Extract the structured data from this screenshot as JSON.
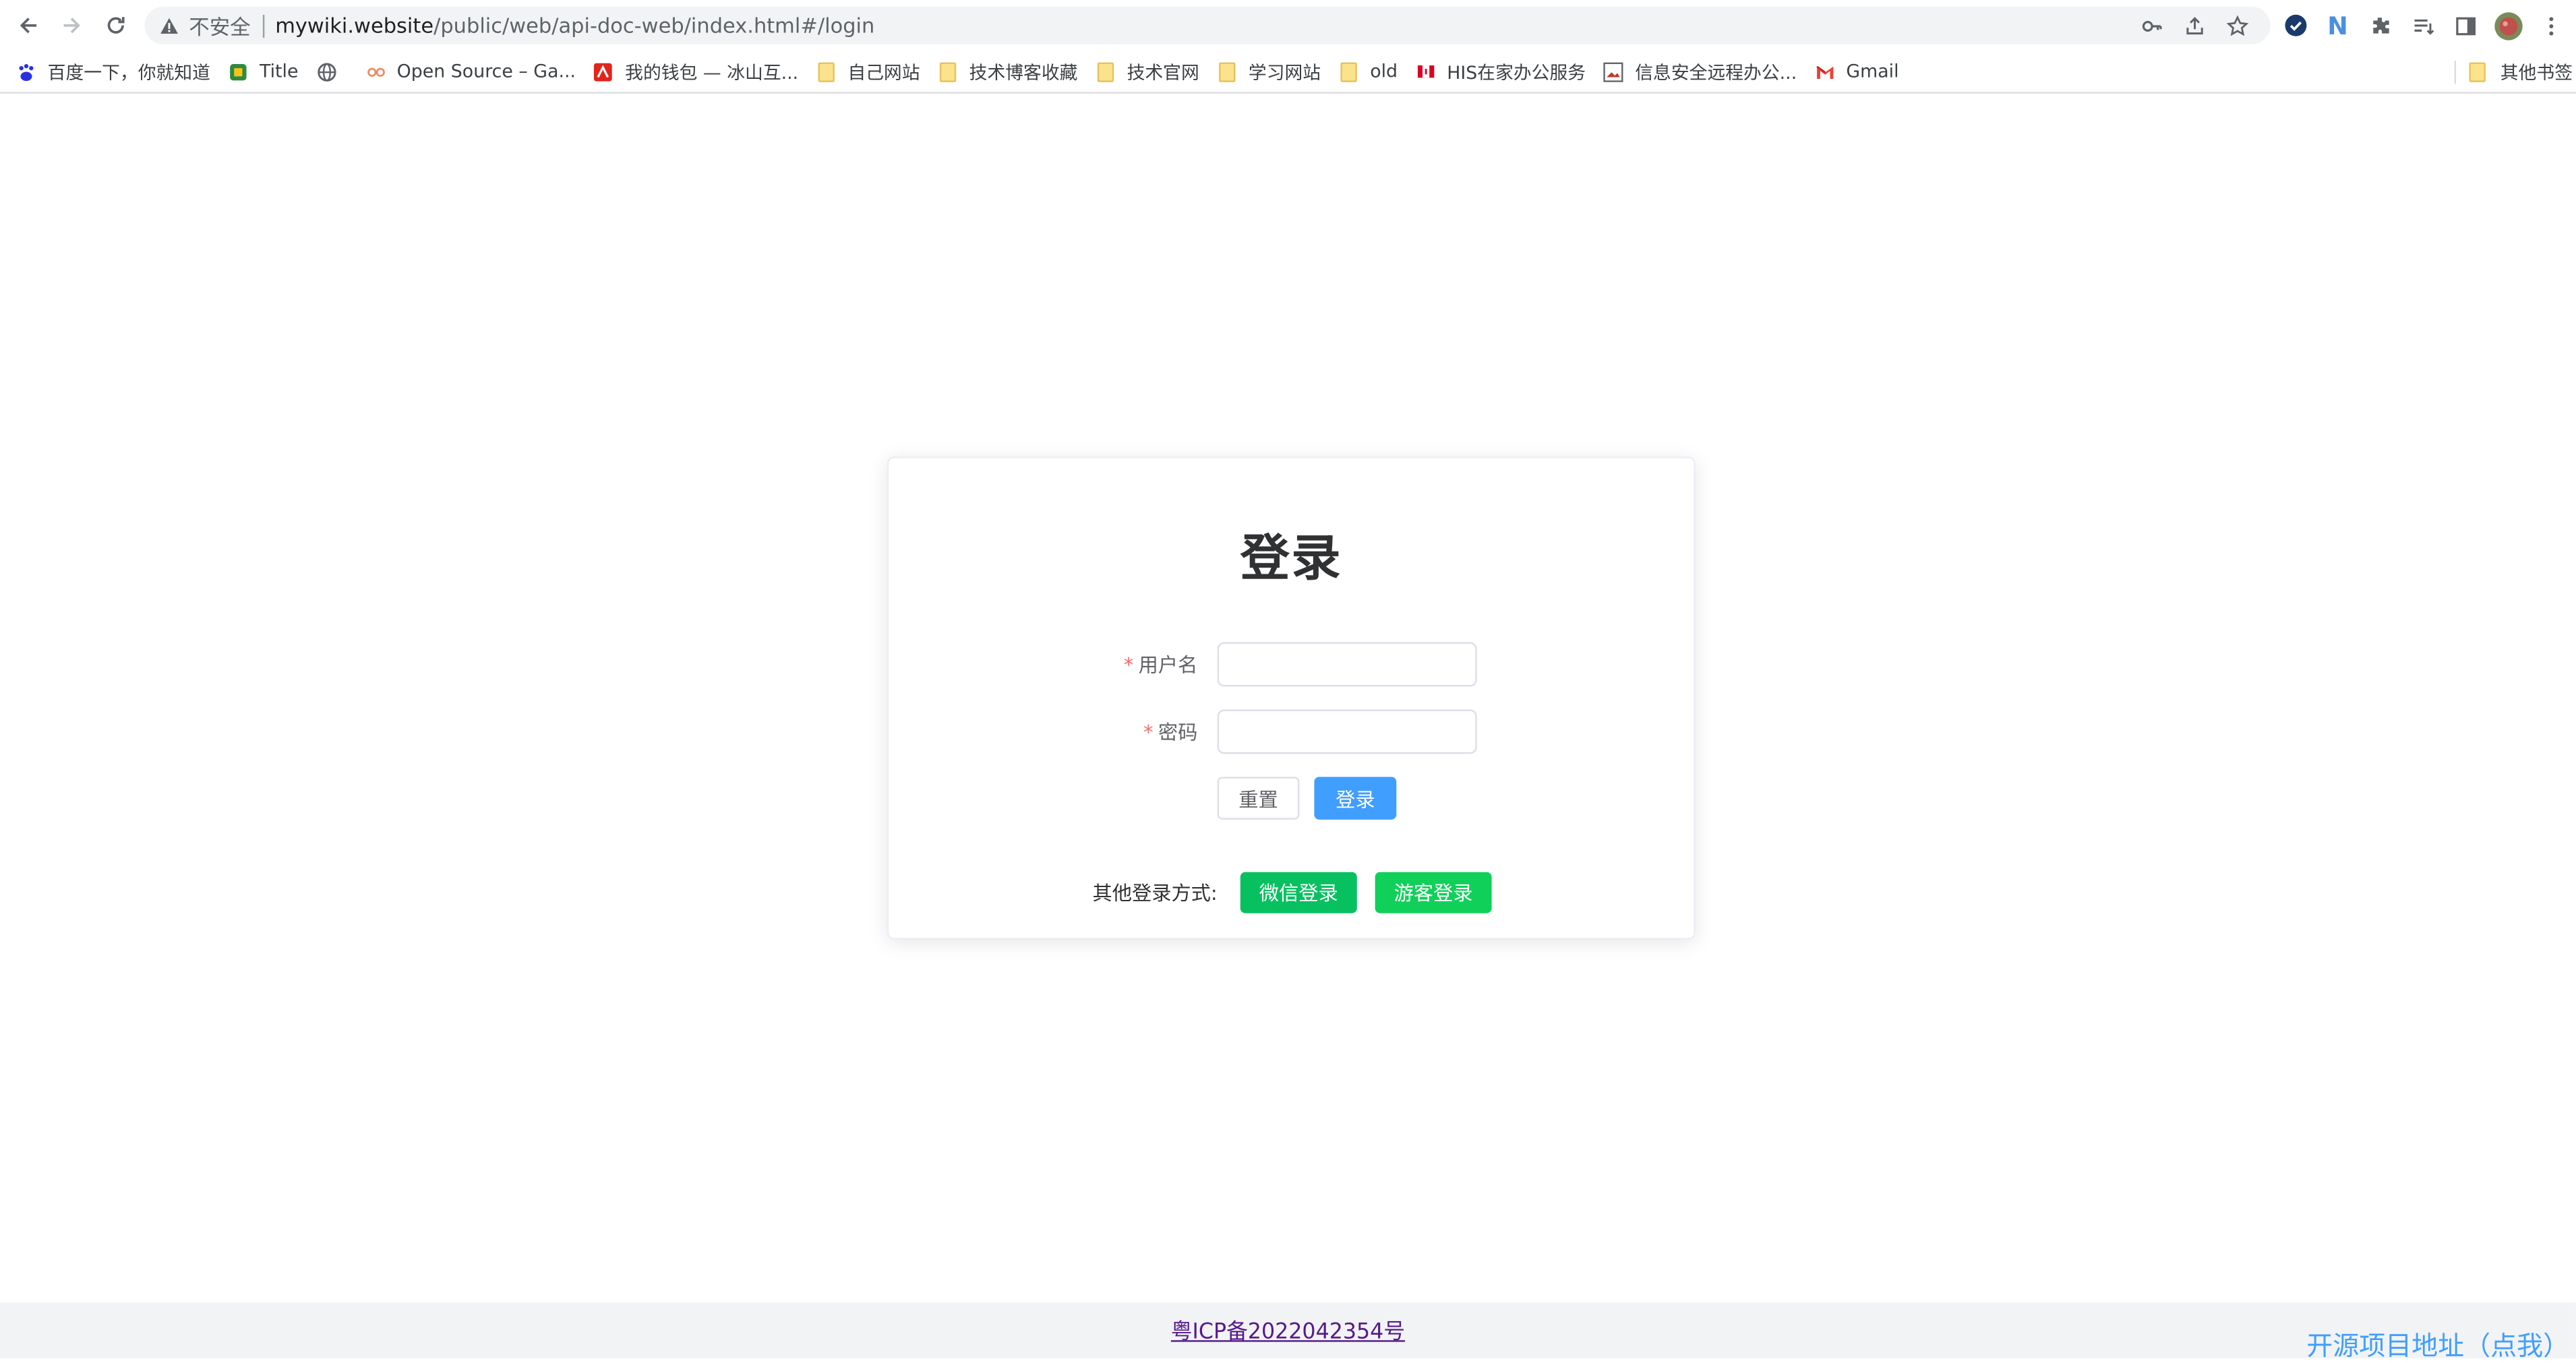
{
  "browser": {
    "security_label": "不安全",
    "url_host": "mywiki.website",
    "url_path": "/public/web/api-doc-web/index.html#/login",
    "bookmarks": [
      {
        "label": "百度一下，你就知道",
        "icon": "baidu-icon"
      },
      {
        "label": "Title",
        "icon": "site-icon"
      },
      {
        "label": "",
        "icon": "globe-icon"
      },
      {
        "label": "Open Source – Ga...",
        "icon": "gitee-icon"
      },
      {
        "label": "我的钱包 — 冰山互...",
        "icon": "wallet-site-icon"
      },
      {
        "label": "自己网站",
        "icon": "folder-icon"
      },
      {
        "label": "技术博客收藏",
        "icon": "folder-icon"
      },
      {
        "label": "技术官网",
        "icon": "folder-icon"
      },
      {
        "label": "学习网站",
        "icon": "folder-icon"
      },
      {
        "label": "old",
        "icon": "folder-icon"
      },
      {
        "label": "HIS在家办公服务",
        "icon": "flag-icon"
      },
      {
        "label": "信息安全远程办公...",
        "icon": "image-icon"
      },
      {
        "label": "Gmail",
        "icon": "gmail-icon"
      }
    ],
    "other_bookmarks": "其他书签"
  },
  "login": {
    "title": "登录",
    "username_label": "用户名",
    "password_label": "密码",
    "username_value": "",
    "password_value": "",
    "required_mark": "*",
    "reset_label": "重置",
    "login_label": "登录",
    "other_methods_label": "其他登录方式:",
    "wechat_label": "微信登录",
    "guest_label": "游客登录"
  },
  "footer": {
    "icp": "粤ICP备2022042354号",
    "open_source": "开源项目地址（点我）"
  },
  "colors": {
    "primary": "#409eff",
    "wechat": "#07c160",
    "guest": "#10d05a",
    "required": "#f56c6c"
  }
}
